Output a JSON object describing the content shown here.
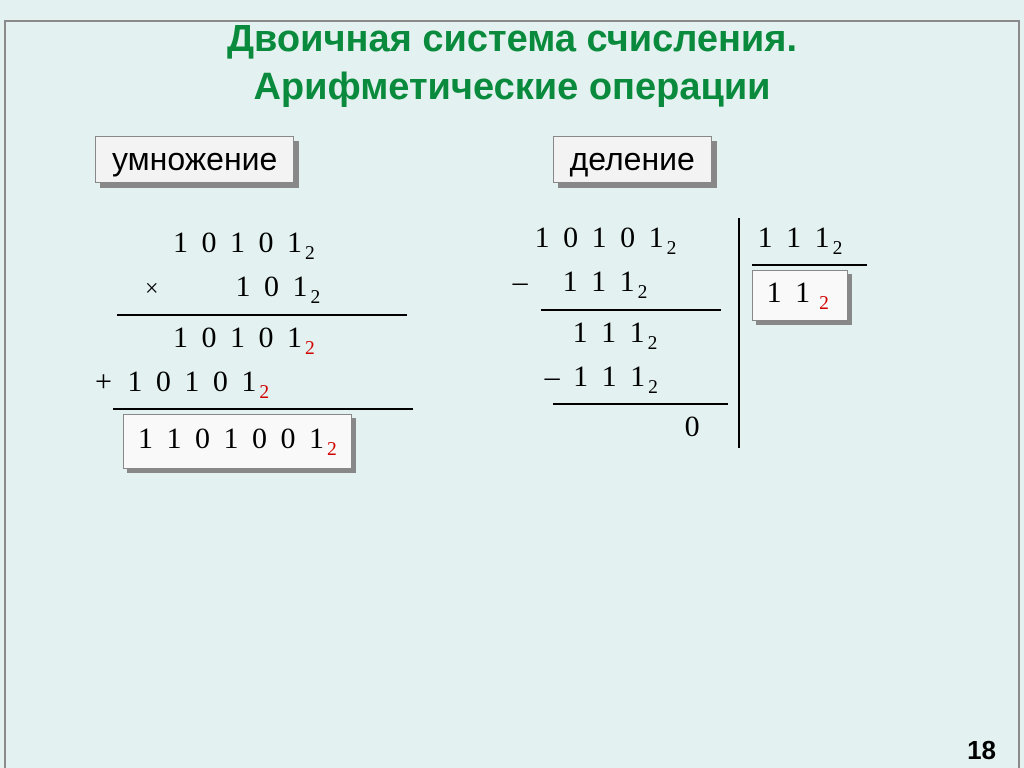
{
  "title_line1": "Двоичная система счисления.",
  "title_line2": "Арифметические операции",
  "labels": {
    "multiplication": "умножение",
    "division": "деление"
  },
  "multiplication": {
    "operand1": "1 0 1 0 1",
    "sub1": "2",
    "operator": "×",
    "operand2": "1 0 1",
    "sub2": "2",
    "partial1": "1 0 1 0 1",
    "partial1_sub": "2",
    "plus": "+",
    "partial2": "1 0 1 0 1",
    "partial2_sub": "2",
    "result": "1 1 0 1 0 0 1",
    "result_sub": "2"
  },
  "division": {
    "dividend": "1 0 1 0 1",
    "dividend_sub": "2",
    "sub_label": "–",
    "first_sub": "1 1 1",
    "first_sub_sub": "2",
    "divisor": "1 1 1",
    "divisor_sub": "2",
    "quotient": "1  1",
    "quotient_sub": "2",
    "remainder1": "1 1 1",
    "remainder1_sub": "2",
    "minus2": "–",
    "second_sub": "1 1 1",
    "second_sub_sub": "2",
    "final": "0"
  },
  "page_number": "18"
}
